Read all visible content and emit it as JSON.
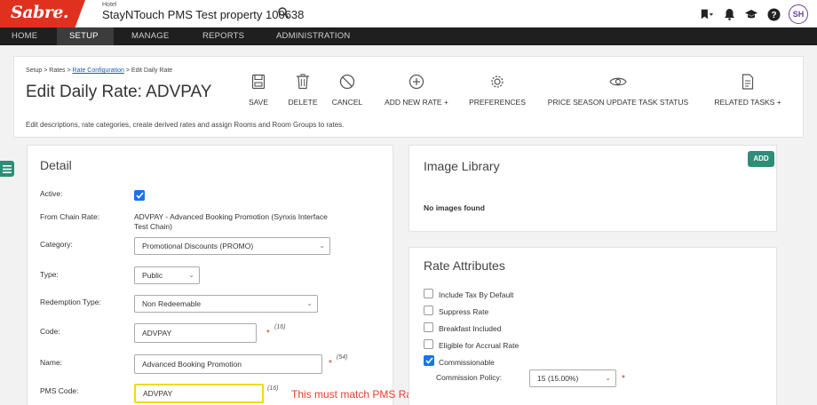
{
  "topbar": {
    "logo": "Sabre.",
    "hotel_caption": "Hotel",
    "hotel_name": "StayNTouch PMS Test property 100638",
    "avatar_initials": "SH"
  },
  "nav": {
    "items": [
      "HOME",
      "SETUP",
      "MANAGE",
      "REPORTS",
      "ADMINISTRATION"
    ],
    "active": "SETUP"
  },
  "header": {
    "breadcrumb": {
      "part1": "Setup > Rates > ",
      "link": "Rate Configuration",
      "part2": " > Edit Daily Rate"
    },
    "title": "Edit Daily Rate: ADVPAY",
    "description": "Edit descriptions, rate categories, create derived rates and assign Rooms and Room Groups to rates.",
    "toolbar": {
      "save": "SAVE",
      "delete": "DELETE",
      "cancel": "CANCEL",
      "add_new_rate": "ADD NEW RATE +",
      "preferences": "PREFERENCES",
      "price_season": "PRICE SEASON UPDATE TASK STATUS",
      "related_tasks": "RELATED TASKS +"
    }
  },
  "detail": {
    "title": "Detail",
    "active_label": "Active:",
    "active_checked": true,
    "from_chain_label": "From Chain Rate:",
    "from_chain_value_line1": "ADVPAY - Advanced Booking Promotion (Synxis Interface",
    "from_chain_value_line2": "Test Chain)",
    "category_label": "Category:",
    "category_value": "Promotional Discounts (PROMO)",
    "type_label": "Type:",
    "type_value": "Public",
    "redemption_label": "Redemption Type:",
    "redemption_value": "Non Redeemable",
    "code_label": "Code:",
    "code_value": "ADVPAY",
    "code_count": "(16)",
    "name_label": "Name:",
    "name_value": "Advanced Booking Promotion",
    "name_count": "(54)",
    "pms_label": "PMS Code:",
    "pms_value": "ADVPAY",
    "pms_count": "(16)",
    "required_mark": "*"
  },
  "annotation": "This must match PMS Rate Code Exactly",
  "image_library": {
    "title": "Image Library",
    "add_label": "ADD",
    "empty_text": "No images found"
  },
  "rate_attributes": {
    "title": "Rate Attributes",
    "items": [
      {
        "label": "Include Tax By Default",
        "checked": false
      },
      {
        "label": "Suppress Rate",
        "checked": false
      },
      {
        "label": "Breakfast Included",
        "checked": false
      },
      {
        "label": "Eligible for Accrual Rate",
        "checked": false
      },
      {
        "label": "Commissionable",
        "checked": true
      }
    ],
    "commission_label": "Commission Policy:",
    "commission_value": "15 (15.00%)"
  },
  "colors": {
    "brand_red": "#e0311f",
    "nav_bg": "#1f1f1f",
    "accent_teal": "#2d8d78",
    "checkbox_blue": "#1a73e8",
    "annotation_red": "#e8402b",
    "highlight_yellow": "#f5d90a"
  }
}
